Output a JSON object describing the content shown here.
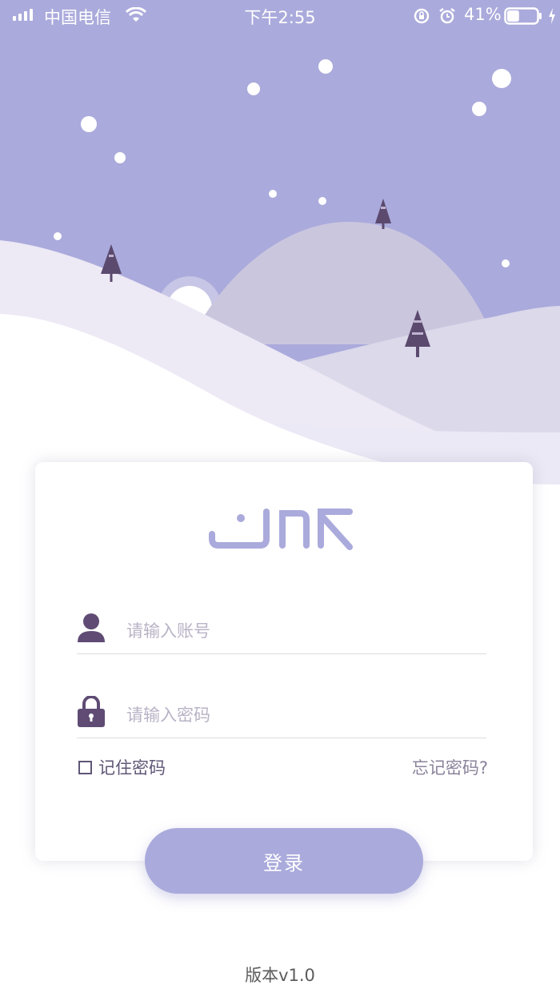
{
  "status_bar": {
    "carrier": "中国电信",
    "time": "下午2:55",
    "battery_percent": "41%",
    "battery_level": 0.41
  },
  "login": {
    "account_placeholder": "请输入账号",
    "password_placeholder": "请输入密码",
    "remember_label": "记住密码",
    "remember_checked": false,
    "forgot_label": "忘记密码?",
    "login_button": "登录"
  },
  "footer": {
    "version": "版本v1.0"
  },
  "colors": {
    "sky": "#aaaadc",
    "accent": "#aaaadc",
    "icon": "#5f4b74",
    "hill_light": "#d8d6e8",
    "hill_mid": "#cac6de",
    "snow": "#f1eef7",
    "tree": "#6b5878"
  }
}
